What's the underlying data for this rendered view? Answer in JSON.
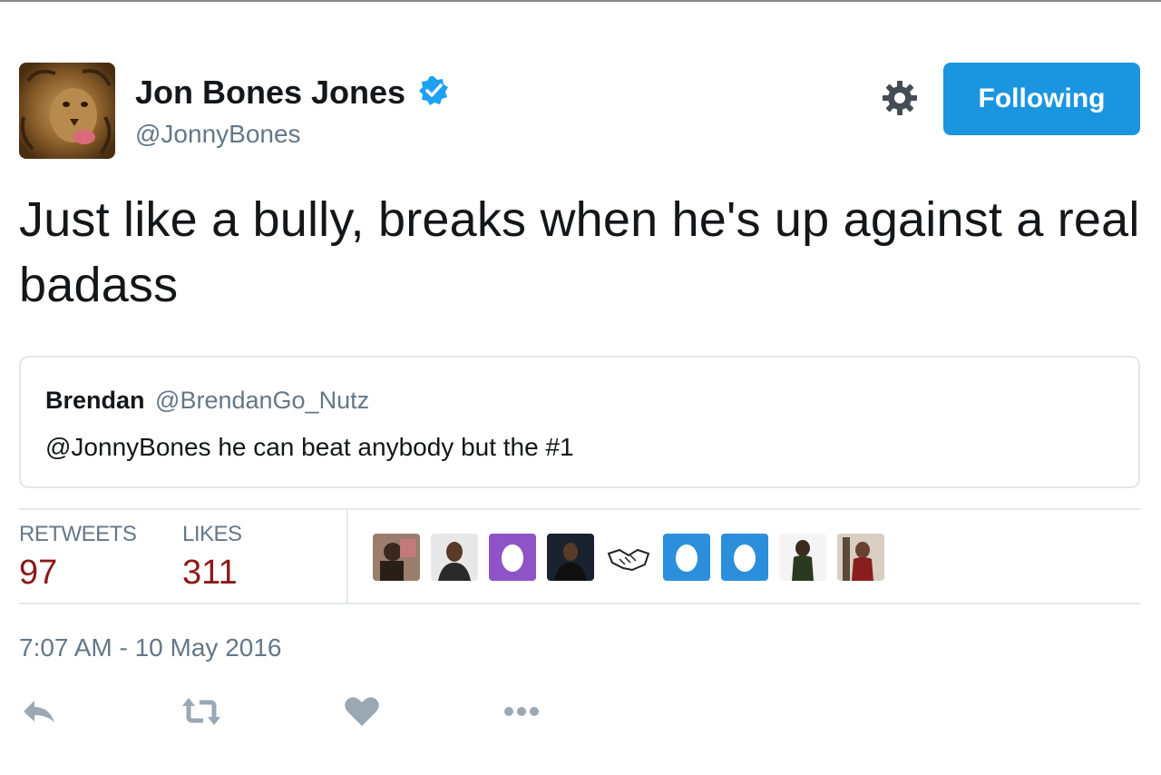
{
  "user": {
    "display_name": "Jon Bones Jones",
    "handle": "@JonnyBones",
    "verified_icon": "verified-badge-icon",
    "avatar": "lion-avatar"
  },
  "header": {
    "follow_label": "Following",
    "settings_icon": "gear-icon"
  },
  "tweet": {
    "text": "Just like a bully, breaks when he's up against a real badass"
  },
  "quote": {
    "name": "Brendan",
    "handle": "@BrendanGo_Nutz",
    "text": "@JonnyBones he can beat anybody but the #1"
  },
  "stats": {
    "retweets_label": "RETWEETS",
    "retweets_count": "97",
    "likes_label": "LIKES",
    "likes_count": "311"
  },
  "likers": [
    "photo-avatar",
    "photo-avatar",
    "egg-avatar",
    "photo-avatar",
    "handshake-avatar",
    "egg-avatar",
    "egg-avatar",
    "photo-avatar",
    "photo-avatar"
  ],
  "timestamp": "7:07 AM - 10 May 2016",
  "actions": [
    "reply-icon",
    "retweet-icon",
    "like-icon",
    "more-icon"
  ],
  "colors": {
    "accent": "#1b95e0",
    "stat_value": "#8b1a1a",
    "muted": "#657786",
    "egg_purple": "#8e54c7",
    "egg_blue": "#2b8fdc"
  }
}
